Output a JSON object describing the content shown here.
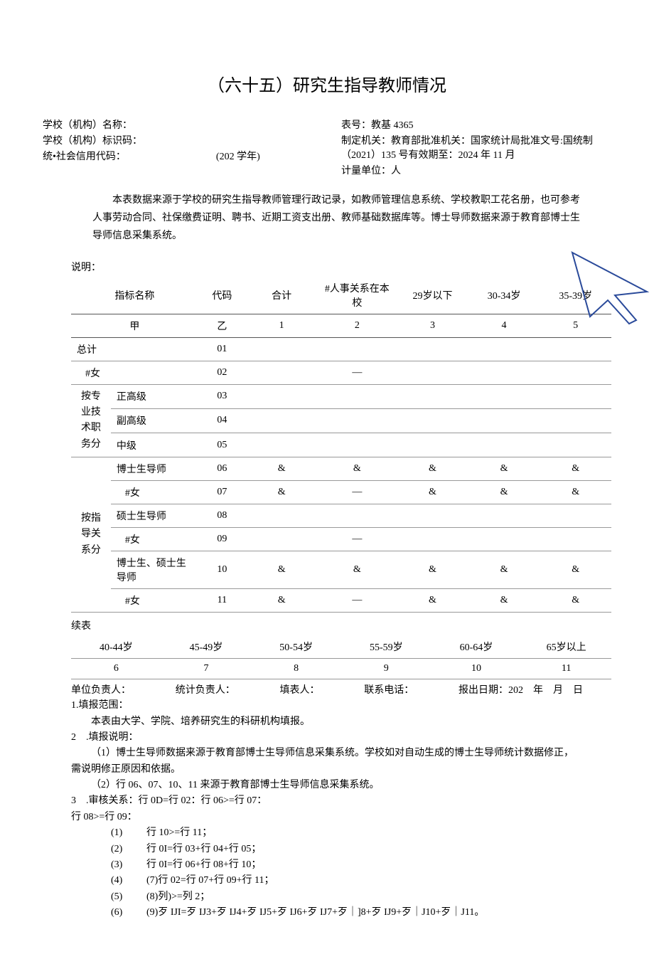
{
  "title": "（六十五）研究生指导教师情况",
  "meta": {
    "left": {
      "school_name_label": "学校（机构）名称：",
      "school_code_label": "学校（机构）标识码：",
      "credit_code_label": "统•社会信用代码：",
      "academic_year": "(202 学年)"
    },
    "right": {
      "form_no": "表号：教基 4365",
      "authority": "制定机关：教育部批准机关：国家统计局批准文号:国统制（2021）135 号有效期至：2024 年 11 月",
      "unit": "计量单位：人"
    }
  },
  "source_note": "本表数据来源于学校的研究生指导教师管理行政记录，如教师管理信息系统、学校教职工花名册，也可参考人事劳动合同、社保缴费证明、聘书、近期工资支出册、教师基础数据库等。博士导师数据来源于教育部博士生导师信息采集系统。",
  "shuoming_label": "说明：",
  "headers": {
    "name": "指标名称",
    "code": "代码",
    "total": "合计",
    "inschool": "#人事关系在本校",
    "a29": "29岁以下",
    "a30": "30-34岁",
    "a35": "35-39岁",
    "jia": "甲",
    "yi": "乙",
    "c1": "1",
    "c2": "2",
    "c3": "3",
    "c4": "4",
    "c5": "5"
  },
  "groups": {
    "g1": "按专业技术职务分",
    "g2": "按指导关系分"
  },
  "rows": [
    {
      "label": "总计",
      "code": "01",
      "v": [
        "",
        "",
        "",
        "",
        ""
      ]
    },
    {
      "label": "#女",
      "code": "02",
      "v": [
        "",
        "—",
        "",
        "",
        ""
      ]
    },
    {
      "label": "正高级",
      "code": "03",
      "v": [
        "",
        "",
        "",
        "",
        ""
      ]
    },
    {
      "label": "副高级",
      "code": "04",
      "v": [
        "",
        "",
        "",
        "",
        ""
      ]
    },
    {
      "label": "中级",
      "code": "05",
      "v": [
        "",
        "",
        "",
        "",
        ""
      ]
    },
    {
      "label": "博士生导师",
      "code": "06",
      "v": [
        "&",
        "&",
        "&",
        "&",
        "&"
      ]
    },
    {
      "label": "#女",
      "code": "07",
      "v": [
        "&",
        "—",
        "&",
        "&",
        "&"
      ]
    },
    {
      "label": "硕士生导师",
      "code": "08",
      "v": [
        "",
        "",
        "",
        "",
        ""
      ]
    },
    {
      "label": "#女",
      "code": "09",
      "v": [
        "",
        "—",
        "",
        "",
        ""
      ]
    },
    {
      "label": "博士生、硕士生导师",
      "code": "10",
      "v": [
        "&",
        "&",
        "&",
        "&",
        "&"
      ]
    },
    {
      "label": "#女",
      "code": "11",
      "v": [
        "&",
        "—",
        "&",
        "&",
        "&"
      ]
    }
  ],
  "cont_label": "续表",
  "cont_headers": {
    "a40": "40-44岁",
    "a45": "45-49岁",
    "a50": "50-54岁",
    "a55": "55-59岁",
    "a60": "60-64岁",
    "a65": "65岁以上",
    "c6": "6",
    "c7": "7",
    "c8": "8",
    "c9": "9",
    "c10": "10",
    "c11": "11"
  },
  "footer": {
    "p1": "单位负责人：",
    "p2": "统计负责人：",
    "p3": "填表人：",
    "p4": "联系电话：",
    "p5": "报出日期：202　年　月　日"
  },
  "notes": {
    "n1_title": "1.填报范围：",
    "n1_body": "本表由大学、学院、培养研究生的科研机构填报。",
    "n2_title": "2　.填报说明：",
    "n2_1": "（1）博士生导师数据来源于教育部博士生导师信息采集系统。学校如对自动生成的博士生导师统计数据修正，需说明修正原因和依据。",
    "n2_2": "（2）行 06、07、10、11 来源于教育部博士生导师信息采集系统。",
    "n3_title": "3　.审核关系：行 0D=行 02：行 06>=行 07：",
    "n3_extra": "行 08>=行 09：",
    "list": [
      {
        "num": "(1)",
        "text": "行 10>=行 11；"
      },
      {
        "num": "(2)",
        "text": "行 0I=行 03+行 04+行 05；"
      },
      {
        "num": "(3)",
        "text": "行 0I=行 06+行 08+行 10；"
      },
      {
        "num": "(4)",
        "text": "(7)行 02=行 07+行 09+行 11；"
      },
      {
        "num": "(5)",
        "text": "(8)列)>=列 2；"
      },
      {
        "num": "(6)",
        "text": "(9)歹 IJI=歹 IJ3+歹 IJ4+歹 IJ5+歹 IJ6+歹 IJ7+歹｜]8+歹 IJ9+歹｜J10+歹｜J11。"
      }
    ]
  }
}
